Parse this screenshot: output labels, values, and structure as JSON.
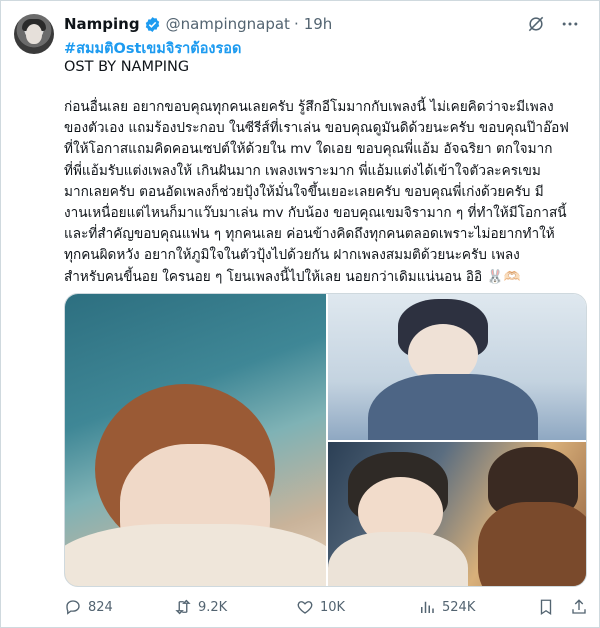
{
  "author": {
    "name": "Namping",
    "handle": "@nampingnapat",
    "separator": "·",
    "time": "19h"
  },
  "post": {
    "hashtag": "#สมมติOstเขมจิราต้องรอด",
    "subtitle": "OST BY NAMPING",
    "body_lines": [
      "ก่อนอื่นเลย อยากขอบคุณทุกคนเลยครับ รู้สึกอีโมมากกับเพลงนี้ ไม่เคยคิดว่าจะมีเพลง",
      "ของตัวเอง แถมร้องประกอบ ในซีรีส์ที่เราเล่น ขอบคุณดูมันดิด้วยนะครับ ขอบคุณป๊าอ๊อฟ",
      "ที่ให้โอกาสแถมคิดคอนเซปต์ให้ด้วยใน mv ใดเอย ขอบคุณพี่แอ้ม อัจฉริยา ตกใจมาก",
      "ที่พี่แอ้มรับแต่งเพลงให้ เกินฝันมาก เพลงเพราะมาก พี่แอ้มแต่งได้เข้าใจตัวละครเขม",
      "มากเลยครับ ตอนอัดเพลงก็ช่วยปุ้งให้มั่นใจขึ้นเยอะเลยครับ ขอบคุณพี่เก่งด้วยครับ มี",
      "งานเหนื่อยแต่ไหนก็มาแว๊บมาเล่น mv กับน้อง ขอบคุณเขมจิรามาก ๆ ที่ทำให้มีโอกาสนี้",
      "และที่สำคัญขอบคุณแฟน ๆ ทุกคนเลย ค่อนข้างคิดถึงทุกคนตลอดเพราะไม่อยากทำให้",
      "ทุกคนผิดหวัง อยากให้ภูมิใจในตัวปุ้งไปด้วยกัน ฝากเพลงสมมติด้วยนะครับ เพลง",
      "สำหรับคนขี้นอย ใครนอย ๆ โยนเพลงนี้ไปให้เลย นอยกว่าเดิมแน่นอน อิอิ 🐰🫶🏻"
    ]
  },
  "stats": {
    "replies": "824",
    "reposts": "9.2K",
    "likes": "10K",
    "views": "524K"
  },
  "colors": {
    "accent": "#1d9bf0",
    "text": "#0f1419",
    "muted": "#536471",
    "border": "#cfd9de"
  },
  "icons": [
    "verified-badge-icon",
    "grok-icon",
    "more-icon",
    "reply-icon",
    "repost-icon",
    "like-icon",
    "views-icon",
    "bookmark-icon",
    "share-icon"
  ]
}
